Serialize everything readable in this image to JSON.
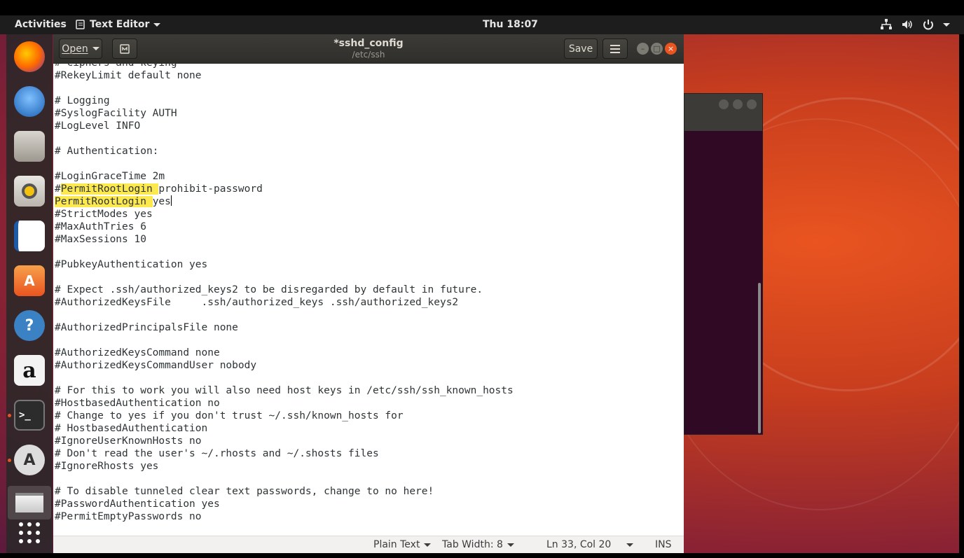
{
  "topbar": {
    "activities": "Activities",
    "app_name": "Text Editor",
    "clock": "Thu 18:07"
  },
  "dock": {
    "items": [
      "firefox-icon",
      "thunderbird-icon",
      "files-icon",
      "rhythmbox-icon",
      "libreoffice-writer-icon",
      "software-center-icon",
      "help-icon",
      "amazon-icon",
      "terminal-icon",
      "software-updater-icon",
      "text-editor-icon",
      "show-applications-icon"
    ],
    "help_glyph": "?",
    "amazon_glyph": "a",
    "terminal_glyph": ">_"
  },
  "editor": {
    "open_label": "Open",
    "save_label": "Save",
    "title": "*sshd_config",
    "subtitle": "/etc/ssh",
    "lines": [
      "# Ciphers and keying",
      "#RekeyLimit default none",
      "",
      "# Logging",
      "#SyslogFacility AUTH",
      "#LogLevel INFO",
      "",
      "# Authentication:",
      "",
      "#LoginGraceTime 2m",
      "#PermitRootLogin prohibit-password",
      "PermitRootLogin yes",
      "#StrictModes yes",
      "#MaxAuthTries 6",
      "#MaxSessions 10",
      "",
      "#PubkeyAuthentication yes",
      "",
      "# Expect .ssh/authorized_keys2 to be disregarded by default in future.",
      "#AuthorizedKeysFile     .ssh/authorized_keys .ssh/authorized_keys2",
      "",
      "#AuthorizedPrincipalsFile none",
      "",
      "#AuthorizedKeysCommand none",
      "#AuthorizedKeysCommandUser nobody",
      "",
      "# For this to work you will also need host keys in /etc/ssh/ssh_known_hosts",
      "#HostbasedAuthentication no",
      "# Change to yes if you don't trust ~/.ssh/known_hosts for",
      "# HostbasedAuthentication",
      "#IgnoreUserKnownHosts no",
      "# Don't read the user's ~/.rhosts and ~/.shosts files",
      "#IgnoreRhosts yes",
      "",
      "# To disable tunneled clear text passwords, change to no here!",
      "#PasswordAuthentication yes",
      "#PermitEmptyPasswords no"
    ],
    "highlight_term": "PermitRootLogin ",
    "highlight_color": "#fce94f"
  },
  "statusbar": {
    "language": "Plain Text",
    "tab_width": "Tab Width: 8",
    "position": "Ln 33, Col 20",
    "mode": "INS"
  },
  "colors": {
    "accent": "#e95420",
    "headerbar": "#3c3b37",
    "terminal_bg": "#300a24"
  }
}
